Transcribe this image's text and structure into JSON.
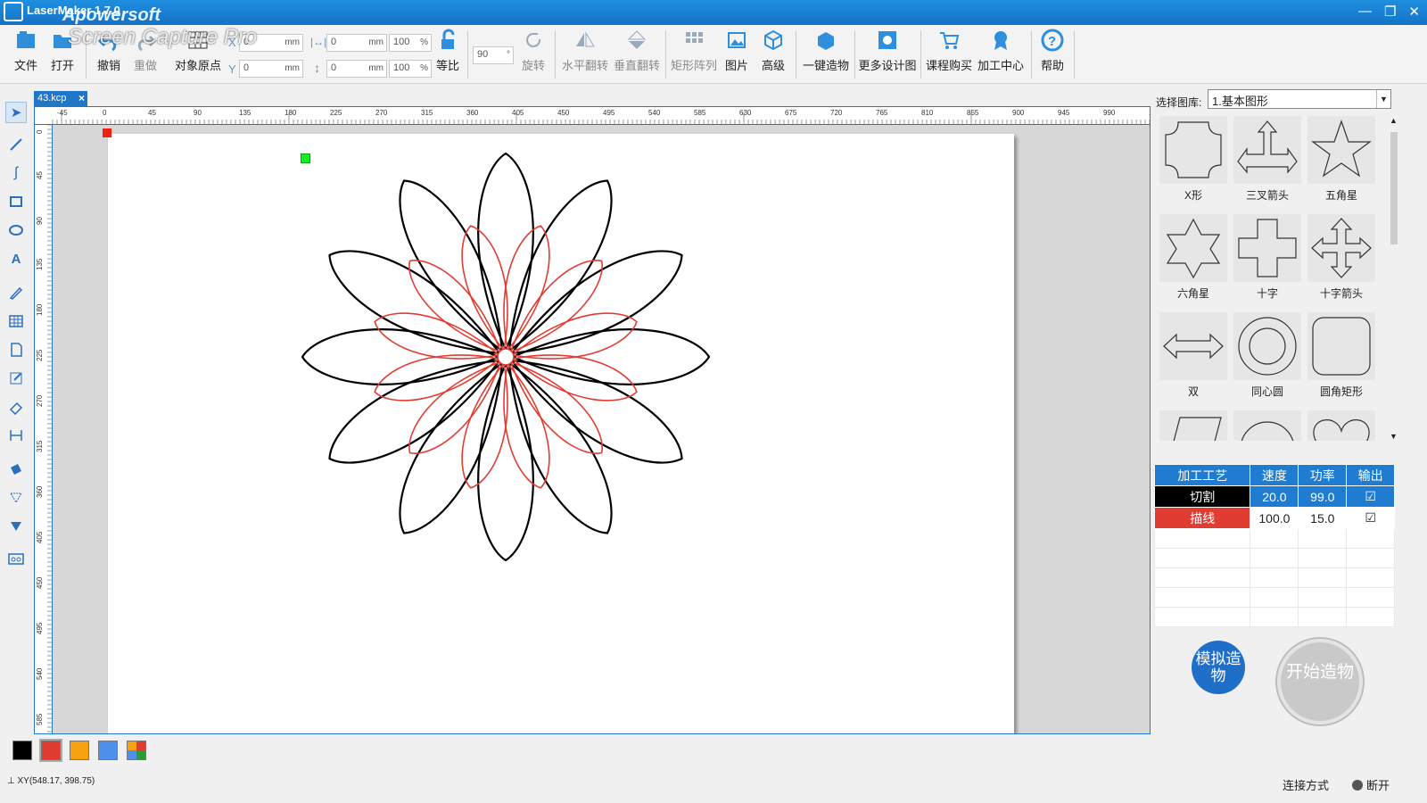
{
  "app": {
    "title": "LaserMaker 1.7.0",
    "watermark_brand": "Apowersoft",
    "watermark_product": "Screen Capture Pro"
  },
  "toolbar": {
    "file": "文件",
    "open": "打开",
    "undo": "撤销",
    "redo": "重做",
    "origin": "对象原点",
    "x_value": "0",
    "y_value": "0",
    "width_value": "0",
    "height_value": "0",
    "unit": "mm",
    "width_pct": "100",
    "height_pct": "100",
    "pct": "%",
    "x_label": "X",
    "y_label": "Y",
    "ratio": "等比",
    "rotate_value": "90",
    "rotate_unit": "°",
    "rotate": "旋转",
    "hflip": "水平翻转",
    "vflip": "垂直翻转",
    "array": "矩形阵列",
    "image": "图片",
    "advanced": "高级",
    "onekey": "一键造物",
    "more_design": "更多设计图",
    "buy_course": "课程购买",
    "process_center": "加工中心",
    "help": "帮助"
  },
  "document_tab": {
    "name": "43.kcp",
    "close": "×"
  },
  "ruler": {
    "h_ticks": [
      "-45",
      "0",
      "45",
      "90",
      "135",
      "180",
      "225",
      "270",
      "315",
      "360",
      "405",
      "450",
      "495",
      "540",
      "585",
      "630",
      "675",
      "720",
      "765",
      "810",
      "855",
      "900",
      "945",
      "990",
      "10"
    ],
    "v_ticks": [
      "0",
      "45",
      "90",
      "135",
      "180",
      "225",
      "270",
      "315",
      "360",
      "405",
      "450",
      "495",
      "540",
      "585"
    ]
  },
  "library": {
    "label": "选择图库:",
    "selected": "1.基本图形",
    "shapes": [
      "X形",
      "三叉箭头",
      "五角星",
      "六角星",
      "十字",
      "十字箭头",
      "双",
      "同心圆",
      "圆角矩形"
    ]
  },
  "process_table": {
    "headers": [
      "加工工艺",
      "速度",
      "功率",
      "输出"
    ],
    "rows": [
      {
        "name": "切割",
        "speed": "20.0",
        "power": "99.0",
        "output": "☑",
        "color": "#000000"
      },
      {
        "name": "描线",
        "speed": "100.0",
        "power": "15.0",
        "output": "☑",
        "color": "#e03c32"
      }
    ]
  },
  "buttons": {
    "simulate": "模拟造物",
    "start": "开始造物"
  },
  "palette": [
    "#000000",
    "#e03c32",
    "#f6a10f",
    "#4d8fea",
    "multicolor"
  ],
  "status": {
    "coords": "XY(548.17, 398.75)",
    "connection": "连接方式",
    "state": "断开"
  },
  "colors": {
    "accent": "#1f7cd0",
    "cut": "#000000",
    "line": "#e03c32"
  }
}
